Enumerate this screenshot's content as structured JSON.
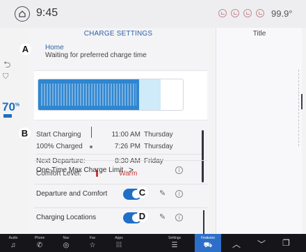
{
  "status_bar": {
    "time": "9:45",
    "temperature": "99.9°",
    "status_icons": [
      "check-circle-icon",
      "check-circle-icon",
      "check-circle-icon",
      "check-circle-icon"
    ]
  },
  "rail": {
    "battery_percent": "70"
  },
  "charge_settings": {
    "title": "CHARGE SETTINGS",
    "location": "Home",
    "status_message": "Waiting for preferred charge time",
    "battery_level_fraction": 0.7,
    "rows": [
      {
        "label": "Start Charging",
        "time": "11:00 AM",
        "day": "Thursday"
      },
      {
        "label": "100% Charged",
        "time": "7:26 PM",
        "day": "Thursday"
      },
      {
        "label": "Next Departure:",
        "time": "8:30 AM",
        "day": "Friday"
      },
      {
        "label": "Comfort Level:",
        "value": "Warm"
      }
    ],
    "settings": [
      {
        "label": "One-Time Max Charge Limit",
        "chevron": ">"
      },
      {
        "label": "Departure and Comfort",
        "toggle_on": true
      },
      {
        "label": "Charging Locations",
        "toggle_on": true
      }
    ]
  },
  "right_panel": {
    "title": "Title"
  },
  "callouts": {
    "a": "A",
    "b": "B",
    "c": "C",
    "d": "D"
  },
  "bottom_nav": {
    "items": [
      {
        "label": "Audio",
        "icon": "music-note-icon",
        "glyph": "♫"
      },
      {
        "label": "Phone",
        "icon": "phone-icon",
        "glyph": "✆"
      },
      {
        "label": "Nav",
        "icon": "navigation-icon",
        "glyph": "◎"
      },
      {
        "label": "Fav",
        "icon": "star-icon",
        "glyph": "☆"
      },
      {
        "label": "Apps",
        "icon": "apps-grid-icon",
        "glyph": "⁞⁞⁞"
      },
      {
        "label": "Settings",
        "icon": "settings-icon",
        "glyph": "☰"
      },
      {
        "label": "Features",
        "icon": "car-icon",
        "glyph": "⛟"
      }
    ],
    "chevron_up": "︿",
    "chevron_down": "﹀",
    "copy_glyph": "❐"
  },
  "colors": {
    "accent_blue": "#1f6fc9",
    "battery_fill": "#2f86d0",
    "warm_red": "#c23a3a"
  }
}
